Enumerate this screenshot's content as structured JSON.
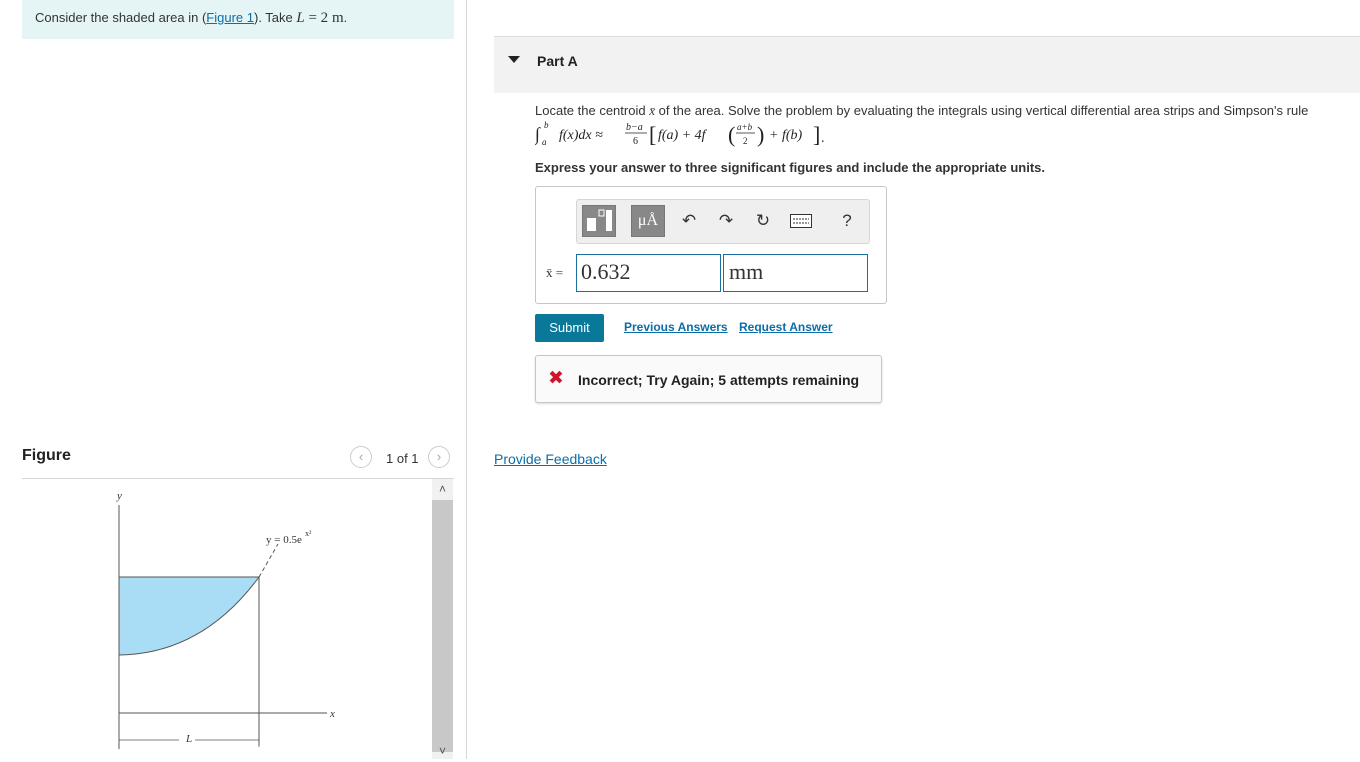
{
  "problem": {
    "prefix": "Consider the shaded area in (",
    "figure_link": "Figure 1",
    "middle": "). Take ",
    "var": "L",
    "equals": " = 2 ",
    "unit": "m",
    "suffix": "."
  },
  "figure": {
    "title": "Figure",
    "pager": "1 of 1",
    "labels": {
      "y_axis": "y",
      "x_axis": "x",
      "curve": "y = 0.5e",
      "exponent": "x²",
      "length": "L"
    },
    "colors": {
      "shade": "#a9dcf5",
      "stroke": "#555555"
    }
  },
  "part": {
    "title": "Part A"
  },
  "question": {
    "text_before": "Locate the centroid ",
    "symbol": "x̄",
    "text_after": " of the area. Solve the problem by evaluating the integrals using vertical differential area strips and Simpson's rule",
    "instruction": "Express your answer to three significant figures and include the appropriate units."
  },
  "formula": {
    "integral": "∫",
    "lower": "a",
    "upper": "b",
    "integrand": "f(x)dx ≈",
    "frac_num": "b−a",
    "frac_den": "6",
    "bracket_open": "[",
    "fa": "f(a) + 4f",
    "paren_open": "(",
    "mid_num": "a+b",
    "mid_den": "2",
    "paren_close": ")",
    "fb": "+ f(b)",
    "bracket_close": "]",
    "end": "."
  },
  "answer": {
    "label": "x̄ =",
    "value": "0.632",
    "unit": "mm",
    "toolbar": {
      "templates_icon": "templates-icon",
      "units_label": "μÅ",
      "help_label": "?"
    }
  },
  "actions": {
    "submit": "Submit",
    "previous_answers": "Previous Answers",
    "request_answer": "Request Answer"
  },
  "feedback": {
    "icon": "✖",
    "text": "Incorrect; Try Again; 5 attempts remaining",
    "color": "#d0152a"
  },
  "provide_feedback": "Provide Feedback",
  "colors": {
    "accent": "#0a7899",
    "link": "#0b6ea8",
    "problem_bg": "#e5f5f6"
  }
}
